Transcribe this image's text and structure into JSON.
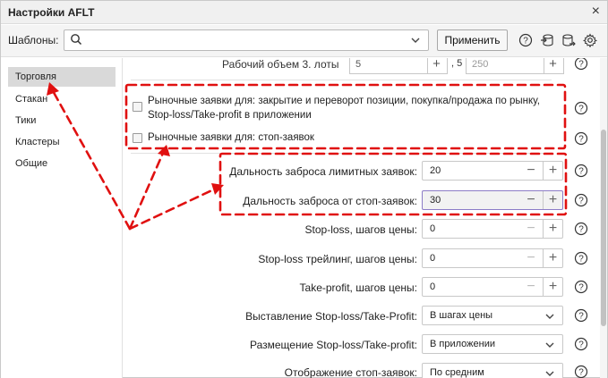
{
  "window": {
    "title": "Настройки AFLT",
    "close_glyph": "×"
  },
  "toolbar": {
    "templates_label": "Шаблоны:",
    "templates_value": "",
    "apply_label": "Применить",
    "icons": [
      "help-icon",
      "db-import-icon",
      "db-export-icon",
      "gear-icon"
    ]
  },
  "sidebar": {
    "items": [
      {
        "label": "Торговля",
        "active": true
      },
      {
        "label": "Стакан"
      },
      {
        "label": "Тики"
      },
      {
        "label": "Кластеры"
      },
      {
        "label": "Общие"
      }
    ]
  },
  "content": {
    "top_row": {
      "label": "Рабочий объем 3. лоты",
      "value1": "5",
      "sep": ", 5",
      "value2": "250"
    },
    "checkboxes": [
      {
        "label": "Рыночные заявки для: закрытие и переворот позиции, покупка/продажа по рынку, Stop-loss/Take-profit в приложении",
        "checked": false
      },
      {
        "label": "Рыночные заявки для: стоп-заявок",
        "checked": false
      }
    ],
    "fields": [
      {
        "label": "Дальность заброса лимитных заявок:",
        "value": "20",
        "type": "number"
      },
      {
        "label": "Дальность заброса от стоп-заявок:",
        "value": "30",
        "type": "number",
        "focused": true
      },
      {
        "label": "Stop-loss, шагов цены:",
        "value": "0",
        "type": "number"
      },
      {
        "label": "Stop-loss трейлинг, шагов цены:",
        "value": "0",
        "type": "number"
      },
      {
        "label": "Take-profit, шагов цены:",
        "value": "0",
        "type": "number"
      },
      {
        "label": "Выставление Stop-loss/Take-Profit:",
        "value": "В шагах цены",
        "type": "select"
      },
      {
        "label": "Размещение Stop-loss/Take-profit:",
        "value": "В приложении",
        "type": "select"
      },
      {
        "label": "Отображение стоп-заявок:",
        "value": "По средним",
        "type": "select"
      }
    ],
    "minus_glyph": "−",
    "plus_glyph": "+"
  },
  "colors": {
    "annotation": "#e01010",
    "active_item": "#d9d9d9",
    "focus_border": "#8c7cc7"
  }
}
